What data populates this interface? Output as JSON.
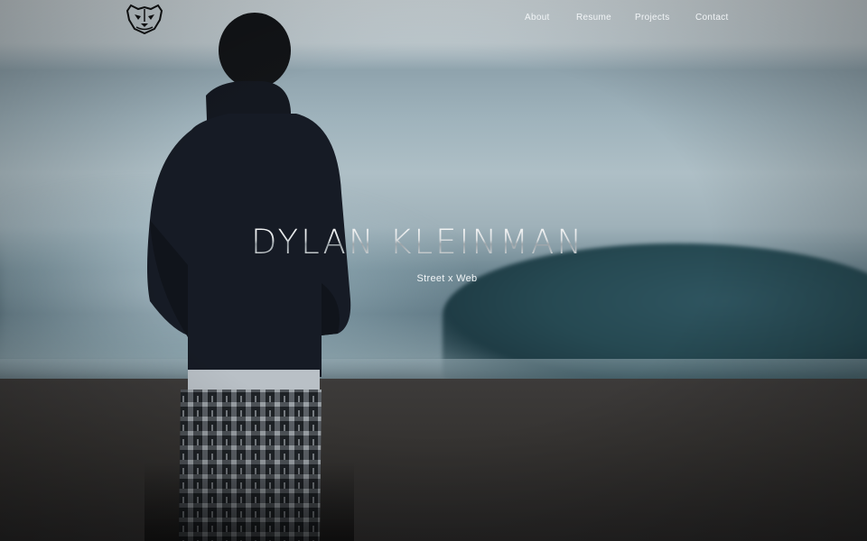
{
  "nav": {
    "logo_icon": "tiger-face-logo-icon",
    "links": [
      {
        "label": "About"
      },
      {
        "label": "Resume"
      },
      {
        "label": "Projects"
      },
      {
        "label": "Contact"
      }
    ]
  },
  "hero": {
    "title": "DYLAN KLEINMAN",
    "subtitle": "Street x Web",
    "background": "person standing on beach facing ocean wave"
  },
  "colors": {
    "nav_text": "#f2f5f7",
    "title_text": "#d6dadc",
    "sky": "#c9d2d6",
    "ocean": "#6f8893",
    "sand": "#353331"
  }
}
